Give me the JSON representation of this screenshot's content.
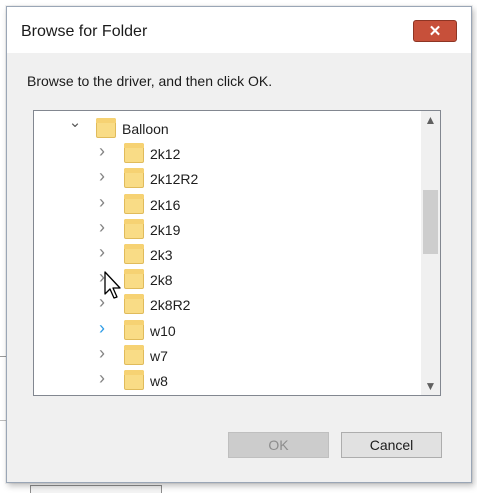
{
  "window": {
    "title": "Browse for Folder",
    "close_glyph": "✕"
  },
  "instruction": "Browse to the driver, and then click OK.",
  "tree": {
    "root": {
      "label": "Balloon",
      "expanded": true
    },
    "children": [
      {
        "label": "2k12"
      },
      {
        "label": "2k12R2"
      },
      {
        "label": "2k16"
      },
      {
        "label": "2k19"
      },
      {
        "label": "2k3"
      },
      {
        "label": "2k8"
      },
      {
        "label": "2k8R2"
      },
      {
        "label": "w10",
        "hovered": true
      },
      {
        "label": "w7"
      },
      {
        "label": "w8"
      }
    ]
  },
  "scrollbar": {
    "up_glyph": "⌃",
    "down_glyph": "⌄"
  },
  "buttons": {
    "ok": {
      "label": "OK",
      "enabled": false
    },
    "cancel": {
      "label": "Cancel"
    }
  },
  "colors": {
    "folder": "#f9dc86",
    "close_button": "#c7503a",
    "hover_chevron": "#2e9ce6"
  }
}
